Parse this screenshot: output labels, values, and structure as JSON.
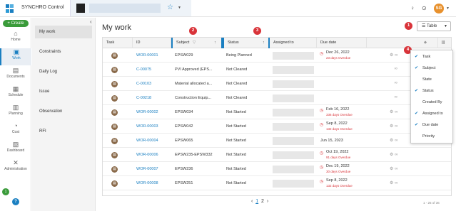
{
  "app": {
    "name": "SYNCHRO Control",
    "avatar": "SG",
    "help_glyph": "?"
  },
  "create": {
    "label": "+ Create"
  },
  "nav": [
    {
      "label": "Home",
      "icon": "home-icon",
      "glyph": "⌂"
    },
    {
      "label": "Work",
      "icon": "work-icon",
      "glyph": "▣",
      "active": true
    },
    {
      "label": "Documents",
      "icon": "documents-icon",
      "glyph": "▤"
    },
    {
      "label": "Schedule",
      "icon": "schedule-icon",
      "glyph": "▦"
    },
    {
      "label": "Planning",
      "icon": "planning-icon",
      "glyph": "▥"
    },
    {
      "label": "Cost",
      "icon": "cost-icon",
      "glyph": "◔"
    },
    {
      "label": "Dashboard",
      "icon": "dashboard-icon",
      "glyph": "▧"
    },
    {
      "label": "Administration",
      "icon": "administration-icon",
      "glyph": "✕"
    }
  ],
  "nav_badge": "1",
  "subnav": [
    "My work",
    "Constraints",
    "Daily Log",
    "Issue",
    "Observation",
    "RFI"
  ],
  "page_title": "My work",
  "table_button": "Table",
  "markers": [
    "1",
    "2",
    "3",
    "4"
  ],
  "columns": [
    "Task",
    "ID",
    "Subject",
    "Status",
    "Assigned to",
    "Due date"
  ],
  "rows": [
    {
      "id": "WOR-00001",
      "subject": "EPSW029",
      "status": "Being Planned",
      "due": "Dec 26, 2022",
      "overdue": "23 days Overdue",
      "late": true
    },
    {
      "id": "C-00075",
      "subject": "PVI Approved (EPS...",
      "status": "Not Cleared",
      "due": "",
      "overdue": "",
      "late": false
    },
    {
      "id": "C-00103",
      "subject": "Material allocated a...",
      "status": "Not Cleared",
      "due": "",
      "overdue": "",
      "late": false
    },
    {
      "id": "C-00218",
      "subject": "Construction Equip...",
      "status": "Not Cleared",
      "due": "",
      "overdue": "",
      "late": false
    },
    {
      "id": "WOR-00002",
      "subject": "EPSW034",
      "status": "Not Started",
      "due": "Feb 16, 2022",
      "overdue": "336 days Overdue",
      "late": true
    },
    {
      "id": "WOR-00003",
      "subject": "EPSW042",
      "status": "Not Started",
      "due": "Sep 8, 2022",
      "overdue": "132 days Overdue",
      "late": true
    },
    {
      "id": "WOR-00004",
      "subject": "EPSW065",
      "status": "Not Started",
      "due": "Jun 15, 2023",
      "overdue": "",
      "late": false
    },
    {
      "id": "WOR-00006",
      "subject": "EPSW235-EPSW332",
      "status": "Not Started",
      "due": "Oct 19, 2022",
      "overdue": "91 days Overdue",
      "late": true
    },
    {
      "id": "WOR-00007",
      "subject": "EPSW236",
      "status": "Not Started",
      "due": "Dec 19, 2022",
      "overdue": "30 days Overdue",
      "late": true
    },
    {
      "id": "WOR-00008",
      "subject": "EPSW251",
      "status": "Not Started",
      "due": "Sep 8, 2022",
      "overdue": "132 days Overdue",
      "late": true
    }
  ],
  "column_menu": [
    {
      "label": "Task",
      "checked": true
    },
    {
      "label": "Subject",
      "checked": true
    },
    {
      "label": "State",
      "checked": false
    },
    {
      "label": "Status",
      "checked": true
    },
    {
      "label": "Created By",
      "checked": false
    },
    {
      "label": "Assigned to",
      "checked": true
    },
    {
      "label": "Due date",
      "checked": true
    },
    {
      "label": "Priority",
      "checked": false
    }
  ],
  "pagination": {
    "prev": "‹",
    "page1": "1",
    "page2": "2",
    "next": "›",
    "range": "1 - 25 of 36"
  },
  "colors": {
    "accent": "#1a7fc1",
    "create": "#3a9b3a",
    "marker": "#d9343a",
    "overdue": "#d9343a"
  }
}
